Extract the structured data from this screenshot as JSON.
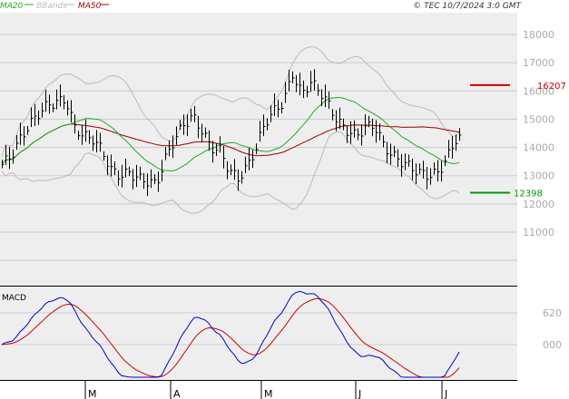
{
  "header": {
    "legend": [
      {
        "label": "MA20",
        "color": "#22aa22"
      },
      {
        "label": "BBands",
        "color": "#bbbbbb"
      },
      {
        "label": "MA50",
        "color": "#990000"
      }
    ],
    "copyright": "© TEC 10/7/2024 3:0 GMT"
  },
  "colors": {
    "panel_bg": "#eeeeee",
    "grid": "#cccccc",
    "price": "#000000",
    "ma20": "#22aa22",
    "ma50": "#990000",
    "bbands": "#bbbbbb",
    "macd": "#0000cc",
    "signal": "#cc0000",
    "resistance": "#cc0000",
    "support": "#009900",
    "axis_text": "#aaaaaa"
  },
  "chart_data": [
    {
      "type": "candlestick",
      "y_ticks": [
        "18000",
        "17000",
        "16000",
        "15000",
        "14000",
        "13000",
        "12000",
        "11000"
      ],
      "x_labels": [
        "M",
        "A",
        "M",
        "J",
        "J"
      ],
      "ylim": [
        10000,
        18500
      ],
      "levels": [
        {
          "name": "resistance",
          "value": 16207,
          "label": "16207"
        },
        {
          "name": "support",
          "value": 12398,
          "label": "12398"
        }
      ],
      "series": [
        {
          "name": "MA20"
        },
        {
          "name": "BBands"
        },
        {
          "name": "MA50"
        }
      ]
    },
    {
      "type": "line",
      "title": "MACD",
      "y_ticks": [
        "620",
        "000"
      ],
      "ylim": [
        -800,
        1300
      ],
      "series": [
        {
          "name": "MACD"
        },
        {
          "name": "signal"
        }
      ]
    }
  ]
}
